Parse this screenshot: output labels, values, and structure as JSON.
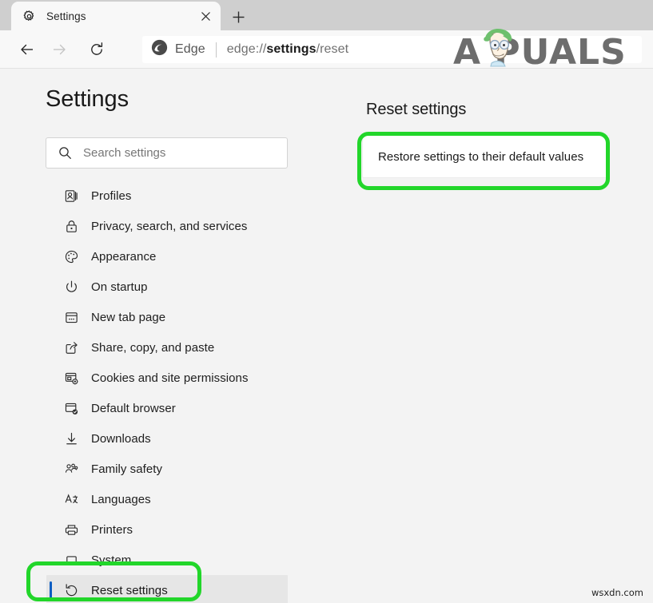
{
  "window": {
    "tab": {
      "title": "Settings",
      "favicon": "gear-icon",
      "close_label": "×"
    },
    "new_tab_label": "+"
  },
  "toolbar": {
    "back_label": "←",
    "forward_label": "→",
    "reload_label": "⟳",
    "brand_label": "Edge",
    "url_prefix": "edge://",
    "url_strong": "settings",
    "url_suffix": "/reset"
  },
  "watermark": {
    "logo_text": "A    PUALS",
    "footer": "wsxdn.com"
  },
  "sidebar": {
    "heading": "Settings",
    "search": {
      "placeholder": "Search settings",
      "value": "",
      "icon": "search-icon"
    },
    "items": [
      {
        "label": "Profiles",
        "icon": "profiles-icon",
        "selected": false
      },
      {
        "label": "Privacy, search, and services",
        "icon": "lock-icon",
        "selected": false
      },
      {
        "label": "Appearance",
        "icon": "palette-icon",
        "selected": false
      },
      {
        "label": "On startup",
        "icon": "power-icon",
        "selected": false
      },
      {
        "label": "New tab page",
        "icon": "new-tab-page-icon",
        "selected": false
      },
      {
        "label": "Share, copy, and paste",
        "icon": "share-icon",
        "selected": false
      },
      {
        "label": "Cookies and site permissions",
        "icon": "cookies-icon",
        "selected": false
      },
      {
        "label": "Default browser",
        "icon": "default-browser-icon",
        "selected": false
      },
      {
        "label": "Downloads",
        "icon": "download-icon",
        "selected": false
      },
      {
        "label": "Family safety",
        "icon": "family-icon",
        "selected": false
      },
      {
        "label": "Languages",
        "icon": "languages-icon",
        "selected": false
      },
      {
        "label": "Printers",
        "icon": "printer-icon",
        "selected": false
      },
      {
        "label": "System",
        "icon": "laptop-icon",
        "selected": false
      },
      {
        "label": "Reset settings",
        "icon": "reset-icon",
        "selected": true
      }
    ]
  },
  "main": {
    "heading": "Reset settings",
    "restore_card_label": "Restore settings to their default values"
  },
  "colors": {
    "annotation_green": "#22d62a",
    "selection_blue": "#0a5dc2",
    "page_background": "#f3f3f3",
    "card_background": "#ffffff"
  }
}
